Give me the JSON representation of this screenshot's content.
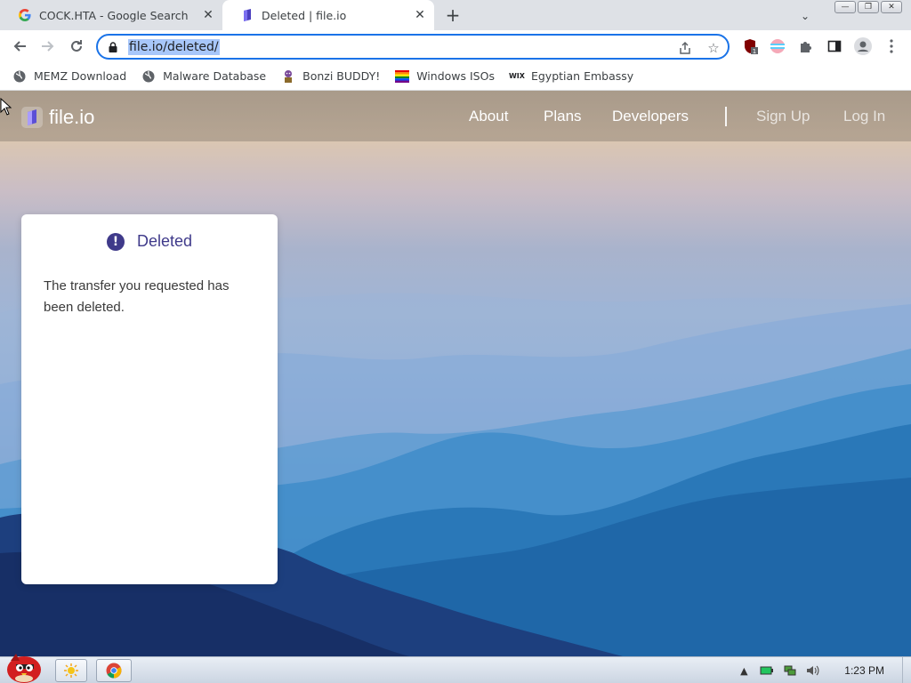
{
  "browser": {
    "tabs": [
      {
        "title": "COCK.HTA - Google Search",
        "active": false
      },
      {
        "title": "Deleted | file.io",
        "active": true
      }
    ],
    "url": "file.io/deleted/",
    "bookmarks": [
      {
        "label": "MEMZ Download",
        "icon": "globe-icon"
      },
      {
        "label": "Malware Database",
        "icon": "globe-icon"
      },
      {
        "label": "Bonzi BUDDY!",
        "icon": "bonzi-icon"
      },
      {
        "label": "Windows ISOs",
        "icon": "rainbow-flag-icon"
      },
      {
        "label": "Egyptian Embassy",
        "icon": "wix-icon"
      }
    ],
    "extension_badge": "1",
    "accent_color": "#1a73e8"
  },
  "site": {
    "logo_text": "file.io",
    "nav": {
      "about": "About",
      "plans": "Plans",
      "developers": "Developers",
      "sign_up": "Sign Up",
      "log_in": "Log In"
    },
    "card": {
      "title": "Deleted",
      "icon": "alert-icon",
      "message": "The transfer you requested has been deleted."
    },
    "brand_color": "#3f3a8a"
  },
  "taskbar": {
    "clock": "1:23 PM"
  }
}
